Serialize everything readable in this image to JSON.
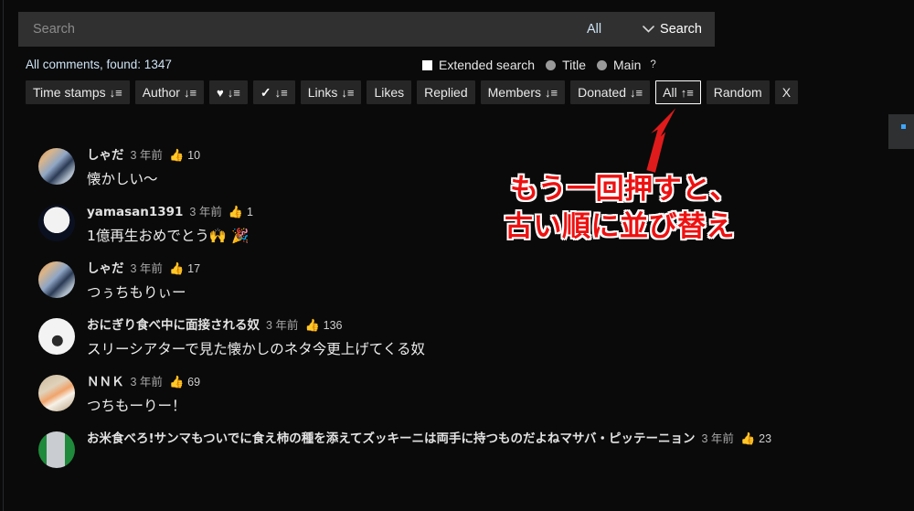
{
  "search": {
    "placeholder": "Search",
    "value": "",
    "scope_selected": "All",
    "scope_options": [
      "All"
    ],
    "chevron_icon": "chevron-down-icon",
    "submit_label": "Search"
  },
  "meta": {
    "found_text": "All comments, found: 1347",
    "extended_search_label": "Extended search",
    "title_label": "Title",
    "main_label": "Main",
    "help_label": "?"
  },
  "sort_buttons": [
    {
      "label": "Time stamps",
      "glyph": "↓≡",
      "icon": "sort-descending-icon",
      "focused": false
    },
    {
      "label": "Author",
      "glyph": "↓≡",
      "icon": "sort-descending-icon",
      "focused": false
    },
    {
      "label": "♥",
      "glyph": "↓≡",
      "icon": "sort-descending-icon",
      "focused": false
    },
    {
      "label": "✓",
      "glyph": "↓≡",
      "icon": "sort-descending-icon",
      "focused": false
    },
    {
      "label": "Links",
      "glyph": "↓≡",
      "icon": "sort-descending-icon",
      "focused": false
    },
    {
      "label": "Likes",
      "glyph": "",
      "icon": "",
      "focused": false
    },
    {
      "label": "Replied",
      "glyph": "",
      "icon": "",
      "focused": false
    },
    {
      "label": "Members",
      "glyph": "↓≡",
      "icon": "sort-descending-icon",
      "focused": false
    },
    {
      "label": "Donated",
      "glyph": "↓≡",
      "icon": "sort-descending-icon",
      "focused": false
    },
    {
      "label": "All",
      "glyph": "↑≡",
      "icon": "sort-ascending-icon",
      "focused": true
    },
    {
      "label": "Random",
      "glyph": "",
      "icon": "",
      "focused": false
    },
    {
      "label": "X",
      "glyph": "",
      "icon": "",
      "focused": false
    }
  ],
  "annotation": {
    "line1": "もう一回押すと、",
    "line2": "古い順に並び替え",
    "color": "#ee1111",
    "outline_color": "#ffffff",
    "arrow_icon": "red-arrow-up-right-icon",
    "arrow_color": "#e01b1b"
  },
  "comments": [
    {
      "author": "しゃだ",
      "time": "3 年前",
      "likes": "10",
      "text": "懐かしい〜",
      "avatar": "avatar-photo-person"
    },
    {
      "author": "yamasan1391",
      "time": "3 年前",
      "likes": "1",
      "text": "1億再生おめでとう🙌 🎉",
      "avatar": "avatar-logo-dark"
    },
    {
      "author": "しゃだ",
      "time": "3 年前",
      "likes": "17",
      "text": "つぅちもりぃー",
      "avatar": "avatar-photo-person"
    },
    {
      "author": "おにぎり食べ中に面接される奴",
      "time": "3 年前",
      "likes": "136",
      "text": "スリーシアターで見た懐かしのネタ今更上げてくる奴",
      "avatar": "avatar-photo-white-bg"
    },
    {
      "author": "ＮＮＫ",
      "time": "3 年前",
      "likes": "69",
      "text": "つちもーりー！",
      "avatar": "avatar-photo-sushi"
    },
    {
      "author": "お米食べろ!サンマもついでに食え柿の種を添えてズッキーニは両手に持つものだよねマサバ・ピッテーニョン",
      "time": "3 年前",
      "likes": "23",
      "text": "",
      "avatar": "avatar-green-phone"
    }
  ]
}
